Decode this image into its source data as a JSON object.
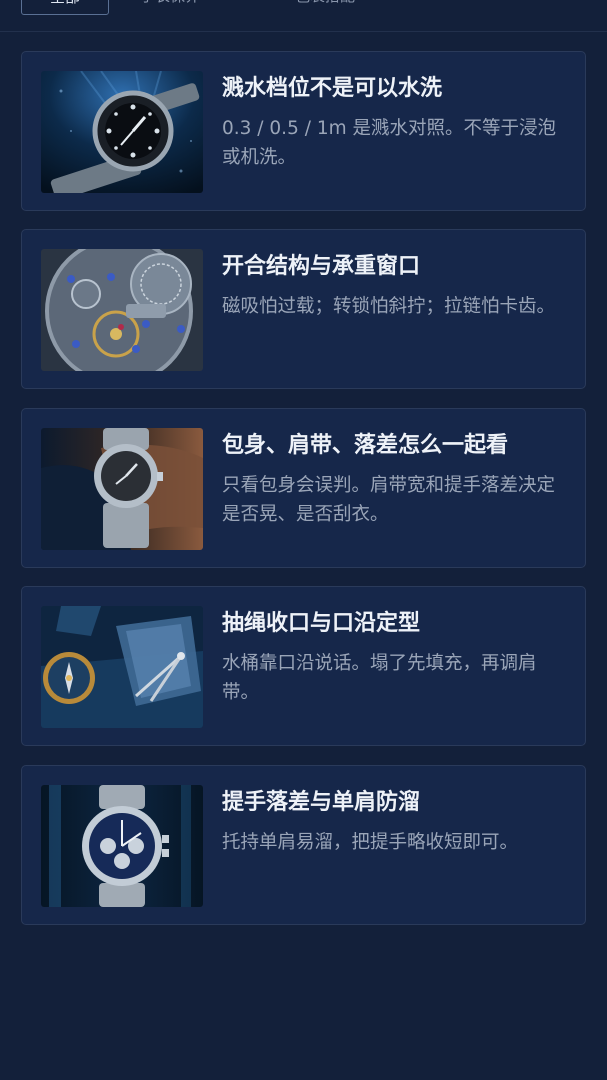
{
  "tabs": [
    {
      "label": "全部"
    },
    {
      "label": "手表保养"
    },
    {
      "label": "包袋搭配"
    }
  ],
  "articles": [
    {
      "title": "溅水档位不是可以水洗",
      "desc": "0.3 / 0.5 / 1m 是溅水对照。不等于浸泡或机洗。",
      "image": "dive-watch-image"
    },
    {
      "title": "开合结构与承重窗口",
      "desc": "磁吸怕过载；转锁怕斜拧；拉链怕卡齿。",
      "image": "watch-movement-image"
    },
    {
      "title": "包身、肩带、落差怎么一起看",
      "desc": "只看包身会误判。肩带宽和提手落差决定是否晃、是否刮衣。",
      "image": "wrist-watch-image"
    },
    {
      "title": "抽绳收口与口沿定型",
      "desc": "水桶靠口沿说话。塌了先填充，再调肩带。",
      "image": "compass-map-image"
    },
    {
      "title": "提手落差与单肩防溜",
      "desc": "托持单肩易溜，把提手略收短即可。",
      "image": "chronograph-watch-image"
    }
  ],
  "colors": {
    "background": "#13203a",
    "card": "#16274a",
    "card_border": "#2a3a5a",
    "title": "#eef2f8",
    "desc": "#9aa5b8"
  }
}
